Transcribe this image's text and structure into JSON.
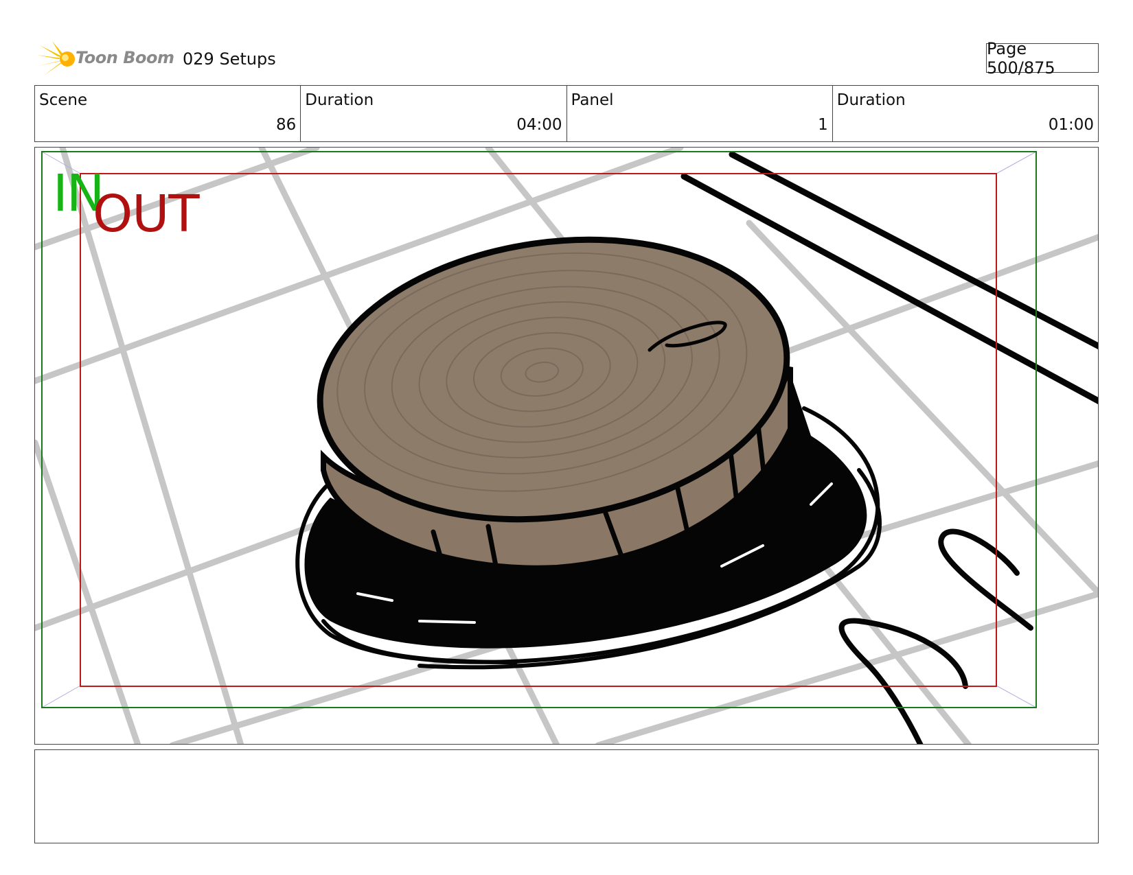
{
  "header": {
    "logo_text": "Toon Boom",
    "project_title": "029 Setups",
    "page_counter": "Page 500/875"
  },
  "info": [
    {
      "label": "Scene",
      "value": "86"
    },
    {
      "label": "Duration",
      "value": "04:00"
    },
    {
      "label": "Panel",
      "value": "1"
    },
    {
      "label": "Duration",
      "value": "01:00"
    }
  ],
  "panel": {
    "in_label": "IN",
    "out_label": "OUT",
    "in_frame_color": "#1a7a1a",
    "out_frame_color": "#c01818",
    "subject": "wooden-cork-stopper-sketch"
  },
  "notes": {
    "text": ""
  }
}
